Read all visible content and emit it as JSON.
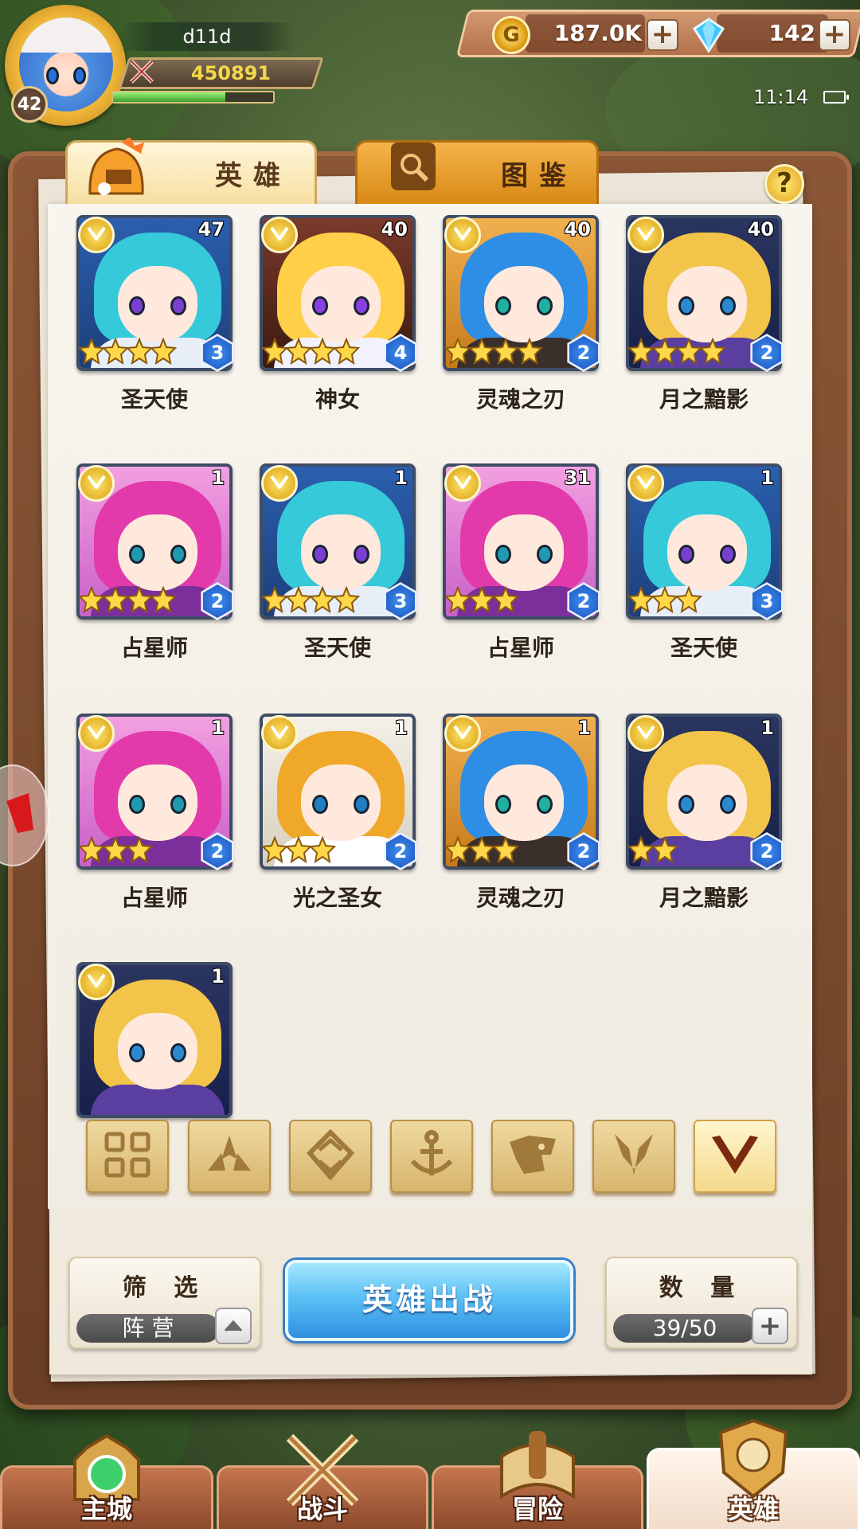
{
  "player": {
    "name": "d11d",
    "level": "42",
    "power": "450891",
    "exp_fraction": 0.7
  },
  "currency": {
    "gold": "187.0K",
    "gems": "142"
  },
  "status": {
    "time": "11:14"
  },
  "tabs": [
    {
      "label": "英雄"
    },
    {
      "label": "图鉴"
    }
  ],
  "help": {
    "label": "?"
  },
  "heroes": [
    {
      "name": "圣天使",
      "level": "47",
      "stars": 4,
      "rank": "3",
      "palette": "angel"
    },
    {
      "name": "神女",
      "level": "40",
      "stars": 4,
      "rank": "4",
      "palette": "goddess"
    },
    {
      "name": "灵魂之刃",
      "level": "40",
      "stars": 4,
      "rank": "2",
      "palette": "blade"
    },
    {
      "name": "月之黯影",
      "level": "40",
      "stars": 4,
      "rank": "2",
      "palette": "moon"
    },
    {
      "name": "占星师",
      "level": "1",
      "stars": 4,
      "rank": "2",
      "palette": "astro"
    },
    {
      "name": "圣天使",
      "level": "1",
      "stars": 4,
      "rank": "3",
      "palette": "angel"
    },
    {
      "name": "占星师",
      "level": "31",
      "stars": 3,
      "rank": "2",
      "palette": "astro"
    },
    {
      "name": "圣天使",
      "level": "1",
      "stars": 3,
      "rank": "3",
      "palette": "angel"
    },
    {
      "name": "占星师",
      "level": "1",
      "stars": 3,
      "rank": "2",
      "palette": "astro"
    },
    {
      "name": "光之圣女",
      "level": "1",
      "stars": 3,
      "rank": "2",
      "palette": "saint"
    },
    {
      "name": "灵魂之刃",
      "level": "1",
      "stars": 3,
      "rank": "2",
      "palette": "blade"
    },
    {
      "name": "月之黯影",
      "level": "1",
      "stars": 2,
      "rank": "2",
      "palette": "moon"
    },
    {
      "name": "",
      "level": "1",
      "stars": 0,
      "rank": "",
      "palette": "moon"
    }
  ],
  "filter_categories": [
    {
      "icon": "grid-all-icon"
    },
    {
      "icon": "crown-spikes-icon"
    },
    {
      "icon": "diamond-chevron-icon"
    },
    {
      "icon": "anchor-icon"
    },
    {
      "icon": "beast-head-icon"
    },
    {
      "icon": "fox-head-icon"
    },
    {
      "icon": "v-emblem-icon"
    }
  ],
  "controls": {
    "filter_title": "筛 选",
    "filter_value": "阵 营",
    "deploy_label": "英雄出战",
    "count_title": "数 量",
    "count_value": "39/50"
  },
  "nav": [
    {
      "label": "主城"
    },
    {
      "label": "战斗"
    },
    {
      "label": "冒险"
    },
    {
      "label": "英雄"
    }
  ],
  "colors": {
    "rank_blue": "#1a4fb8",
    "gold": "#e2a21a",
    "deploy_blue": "#5cc1f5",
    "book_brown": "#6b3f25"
  }
}
